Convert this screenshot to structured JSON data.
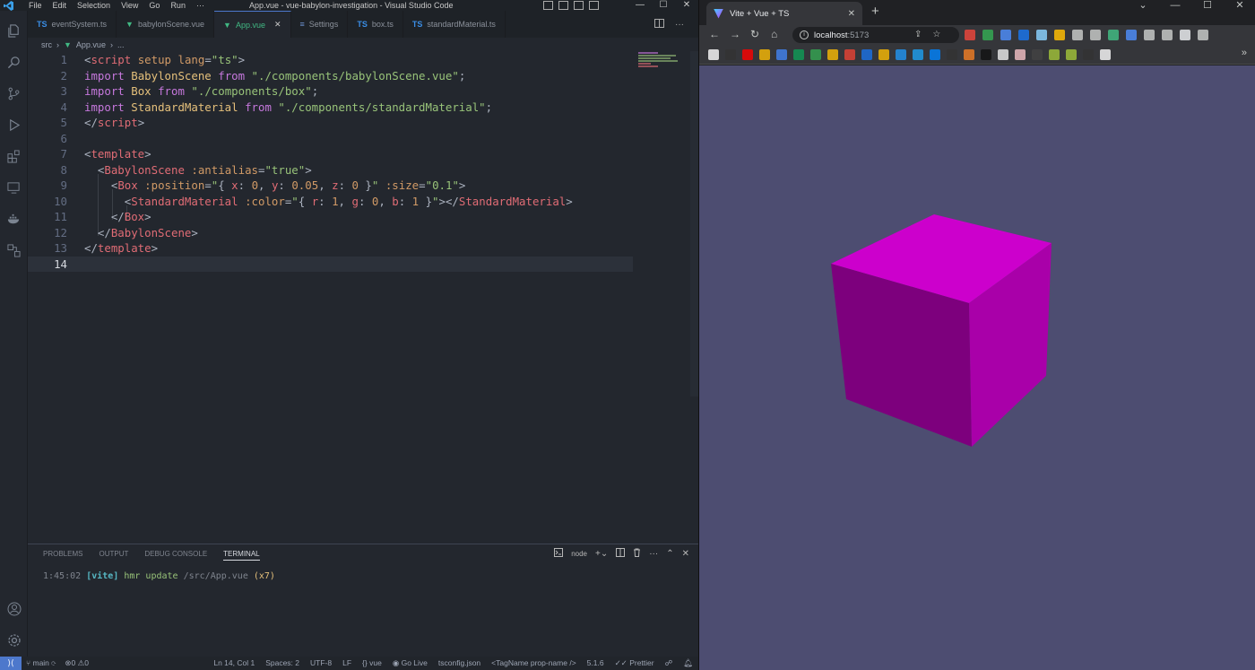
{
  "vscode": {
    "menu": [
      "File",
      "Edit",
      "Selection",
      "View",
      "Go",
      "Run",
      "···"
    ],
    "window_title": "App.vue - vue-babylon-investigation - Visual Studio Code",
    "tabs": [
      {
        "label": "eventSystem.ts",
        "icon": "TS",
        "kind": "ts"
      },
      {
        "label": "babylonScene.vue",
        "icon": "▼",
        "kind": "vue"
      },
      {
        "label": "App.vue",
        "icon": "▼",
        "kind": "vue",
        "active": true
      },
      {
        "label": "Settings",
        "icon": "≡",
        "kind": "set"
      },
      {
        "label": "box.ts",
        "icon": "TS",
        "kind": "ts"
      },
      {
        "label": "standardMaterial.ts",
        "icon": "TS",
        "kind": "ts"
      }
    ],
    "breadcrumb": {
      "folder": "src",
      "file": "App.vue",
      "rest": "..."
    },
    "code_lines": [
      {
        "n": "1",
        "tokens": [
          [
            "punct",
            "<"
          ],
          [
            "tag",
            "script"
          ],
          [
            "plain",
            " "
          ],
          [
            "attr",
            "setup"
          ],
          [
            "plain",
            " "
          ],
          [
            "attr",
            "lang"
          ],
          [
            "punct",
            "="
          ],
          [
            "str",
            "\"ts\""
          ],
          [
            "punct",
            ">"
          ]
        ]
      },
      {
        "n": "2",
        "tokens": [
          [
            "kw",
            "import"
          ],
          [
            "plain",
            " "
          ],
          [
            "comp",
            "BabylonScene"
          ],
          [
            "plain",
            " "
          ],
          [
            "kw",
            "from"
          ],
          [
            "plain",
            " "
          ],
          [
            "str",
            "\"./components/babylonScene.vue\""
          ],
          [
            "punct",
            ";"
          ]
        ]
      },
      {
        "n": "3",
        "tokens": [
          [
            "kw",
            "import"
          ],
          [
            "plain",
            " "
          ],
          [
            "comp",
            "Box"
          ],
          [
            "plain",
            " "
          ],
          [
            "kw",
            "from"
          ],
          [
            "plain",
            " "
          ],
          [
            "str",
            "\"./components/box\""
          ],
          [
            "punct",
            ";"
          ]
        ]
      },
      {
        "n": "4",
        "tokens": [
          [
            "kw",
            "import"
          ],
          [
            "plain",
            " "
          ],
          [
            "comp",
            "StandardMaterial"
          ],
          [
            "plain",
            " "
          ],
          [
            "kw",
            "from"
          ],
          [
            "plain",
            " "
          ],
          [
            "str",
            "\"./components/standardMaterial\""
          ],
          [
            "punct",
            ";"
          ]
        ]
      },
      {
        "n": "5",
        "tokens": [
          [
            "punct",
            "</"
          ],
          [
            "tag",
            "script"
          ],
          [
            "punct",
            ">"
          ]
        ]
      },
      {
        "n": "6",
        "tokens": []
      },
      {
        "n": "7",
        "tokens": [
          [
            "punct",
            "<"
          ],
          [
            "tag",
            "template"
          ],
          [
            "punct",
            ">"
          ]
        ]
      },
      {
        "n": "8",
        "tokens": [
          [
            "plain",
            "  "
          ],
          [
            "punct",
            "<"
          ],
          [
            "tag",
            "BabylonScene"
          ],
          [
            "plain",
            " "
          ],
          [
            "attr",
            ":antialias"
          ],
          [
            "punct",
            "="
          ],
          [
            "str",
            "\"true\""
          ],
          [
            "punct",
            ">"
          ]
        ]
      },
      {
        "n": "9",
        "tokens": [
          [
            "plain",
            "    "
          ],
          [
            "punct",
            "<"
          ],
          [
            "tag",
            "Box"
          ],
          [
            "plain",
            " "
          ],
          [
            "attr",
            ":position"
          ],
          [
            "punct",
            "="
          ],
          [
            "str",
            "\""
          ],
          [
            "punct",
            "{ "
          ],
          [
            "prop",
            "x"
          ],
          [
            "punct",
            ": "
          ],
          [
            "num",
            "0"
          ],
          [
            "punct",
            ", "
          ],
          [
            "prop",
            "y"
          ],
          [
            "punct",
            ": "
          ],
          [
            "num",
            "0.05"
          ],
          [
            "punct",
            ", "
          ],
          [
            "prop",
            "z"
          ],
          [
            "punct",
            ": "
          ],
          [
            "num",
            "0"
          ],
          [
            "punct",
            " }"
          ],
          [
            "str",
            "\""
          ],
          [
            "plain",
            " "
          ],
          [
            "attr",
            ":size"
          ],
          [
            "punct",
            "="
          ],
          [
            "str",
            "\"0.1\""
          ],
          [
            "punct",
            ">"
          ]
        ]
      },
      {
        "n": "10",
        "tokens": [
          [
            "plain",
            "      "
          ],
          [
            "punct",
            "<"
          ],
          [
            "tag",
            "StandardMaterial"
          ],
          [
            "plain",
            " "
          ],
          [
            "attr",
            ":color"
          ],
          [
            "punct",
            "="
          ],
          [
            "str",
            "\""
          ],
          [
            "punct",
            "{ "
          ],
          [
            "prop",
            "r"
          ],
          [
            "punct",
            ": "
          ],
          [
            "num",
            "1"
          ],
          [
            "punct",
            ", "
          ],
          [
            "prop",
            "g"
          ],
          [
            "punct",
            ": "
          ],
          [
            "num",
            "0"
          ],
          [
            "punct",
            ", "
          ],
          [
            "prop",
            "b"
          ],
          [
            "punct",
            ": "
          ],
          [
            "num",
            "1"
          ],
          [
            "punct",
            " }"
          ],
          [
            "str",
            "\""
          ],
          [
            "punct",
            "></"
          ],
          [
            "tag",
            "StandardMaterial"
          ],
          [
            "punct",
            ">"
          ]
        ]
      },
      {
        "n": "11",
        "tokens": [
          [
            "plain",
            "    "
          ],
          [
            "punct",
            "</"
          ],
          [
            "tag",
            "Box"
          ],
          [
            "punct",
            ">"
          ]
        ]
      },
      {
        "n": "12",
        "tokens": [
          [
            "plain",
            "  "
          ],
          [
            "punct",
            "</"
          ],
          [
            "tag",
            "BabylonScene"
          ],
          [
            "punct",
            ">"
          ]
        ]
      },
      {
        "n": "13",
        "tokens": [
          [
            "punct",
            "</"
          ],
          [
            "tag",
            "template"
          ],
          [
            "punct",
            ">"
          ]
        ]
      },
      {
        "n": "14",
        "tokens": [],
        "current": true
      }
    ],
    "panel": {
      "tabs": [
        "PROBLEMS",
        "OUTPUT",
        "DEBUG CONSOLE",
        "TERMINAL"
      ],
      "active_tab": "TERMINAL",
      "terminal_name": "node",
      "terminal_time": "1:45:02",
      "terminal_tag": "[vite]",
      "terminal_msg": "hmr update",
      "terminal_path": "/src/App.vue",
      "terminal_count": "(x7)"
    },
    "status": {
      "branch": "main",
      "errors": "0",
      "warnings": "0",
      "position": "Ln 14, Col 1",
      "spaces": "Spaces: 2",
      "encoding": "UTF-8",
      "eol": "LF",
      "language": "vue",
      "golive": "Go Live",
      "tsconfig": "tsconfig.json",
      "tagname": "<TagName prop-name />",
      "version": "5.1.6",
      "prettier": "Prettier"
    }
  },
  "browser": {
    "tab_title": "Vite + Vue + TS",
    "url_host": "localhost",
    "url_port": ":5173",
    "viewport_bg": "#4d4d71",
    "cube_color": "#cc00cc"
  }
}
